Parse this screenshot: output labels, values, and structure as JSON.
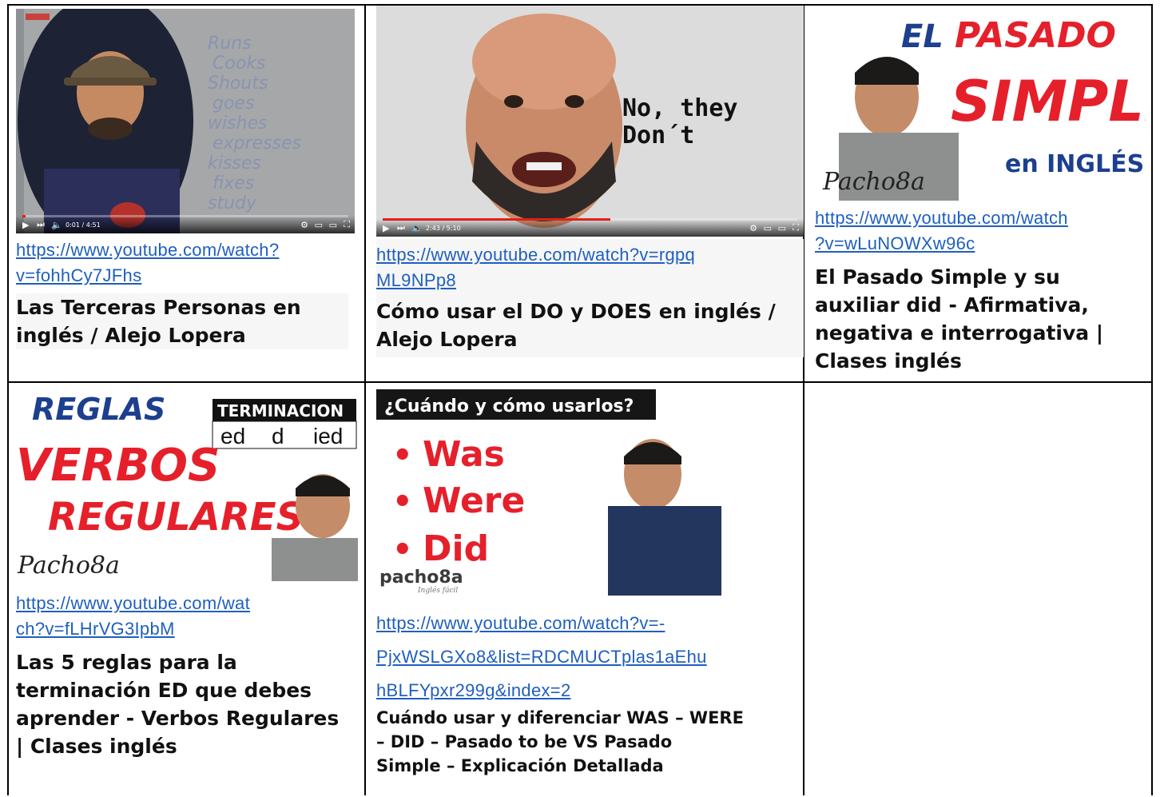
{
  "cells": [
    {
      "url_line1": "https://www.youtube.com/watch?",
      "url_line2": "v=fohhCy7JFhs",
      "title_lines": [
        "Las Terceras Personas en",
        "inglés / Alejo Lopera"
      ],
      "whiteboard_words": [
        "Runs",
        "Cooks",
        "Shouts",
        "goes",
        "wishes",
        "expresses",
        "kisses",
        "fixes",
        "study"
      ],
      "player_time": "0:01 / 4:51",
      "progress_fraction": 0.0
    },
    {
      "url_line1": "https://www.youtube.com/watch?v=rgpq",
      "url_line2": "ML9NPp8",
      "title_lines": [
        "Cómo usar el DO y DOES en inglés /",
        "Alejo Lopera"
      ],
      "thumb_text": [
        "No, they",
        "Don´t"
      ],
      "player_time": "2:43 / 5:10",
      "progress_fraction": 0.55
    },
    {
      "url_line1": "https://www.youtube.com/watch",
      "url_line2": "?v=wLuNOWXw96c",
      "title_lines": [
        "El Pasado Simple y su",
        "auxiliar did - Afirmativa,",
        "negativa e interrogativa |",
        "Clases inglés"
      ],
      "thumb_text": [
        "EL",
        "PASADO",
        "SIMPLE",
        "en INGLÉS"
      ],
      "logo": "Pacho8a"
    },
    {
      "url_line1": "https://www.youtube.com/wat",
      "url_line2": "ch?v=fLHrVG3IpbM",
      "title_lines": [
        "Las 5 reglas para la",
        "terminación ED que debes",
        "aprender - Verbos Regulares",
        "| Clases inglés"
      ],
      "thumb_text": [
        "REGLAS",
        "TERMINACION",
        "ed",
        "d",
        "ied",
        "VERBOS",
        "REGULARES"
      ],
      "logo": "Pacho8a"
    },
    {
      "url_line1": "https://www.youtube.com/watch?v=-",
      "url_line2": "PjxWSLGXo8&list=RDCMUCTplas1aEhu",
      "url_line3": "hBLFYpxr299g&index=2",
      "title_lines": [
        "Cuándo usar y diferenciar WAS – WERE",
        "– DID – Pasado to be VS Pasado",
        "Simple – Explicación Detallada"
      ],
      "thumb_text": [
        "¿Cuándo y cómo usarlos?",
        "Was",
        "Were",
        "Did"
      ],
      "logo": "pacho8a",
      "logo_sub": "Inglés fácil"
    }
  ],
  "colors": {
    "link": "#1f5fbf",
    "red": "#e5202b",
    "blue_title": "#1c3f8f",
    "border": "#000000"
  }
}
